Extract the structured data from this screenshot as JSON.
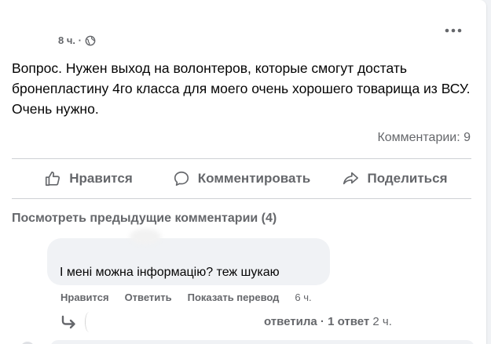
{
  "post": {
    "time": "8 ч. ·",
    "text": "Вопрос. Нужен выход на волонтеров, которые смогут достать бронепластину 4го класса для моего очень хорошего товарища из ВСУ. Очень нужно.",
    "comments_count": "Комментарии: 9"
  },
  "actions": {
    "like": "Нравится",
    "comment": "Комментировать",
    "share": "Поделиться"
  },
  "comments": {
    "view_previous": "Посмотреть предыдущие комментарии (4)",
    "items": [
      {
        "text": "І мені можна інформацію? теж шукаю",
        "like": "Нравится",
        "reply": "Ответить",
        "translate": "Показать перевод",
        "time": "6 ч.",
        "replies": {
          "summary": "ответила · 1 ответ",
          "time": "2 ч."
        }
      }
    ]
  },
  "icons": {
    "globe": "globe-icon",
    "more": "more-options-icon",
    "like": "thumbs-up-icon",
    "comment": "comment-bubble-icon",
    "share": "share-arrow-icon",
    "reply": "reply-arrow-icon"
  },
  "colors": {
    "secondary_text": "#65676b",
    "primary_text": "#050505",
    "bubble": "#f0f2f5",
    "divider": "#ced0d4"
  }
}
